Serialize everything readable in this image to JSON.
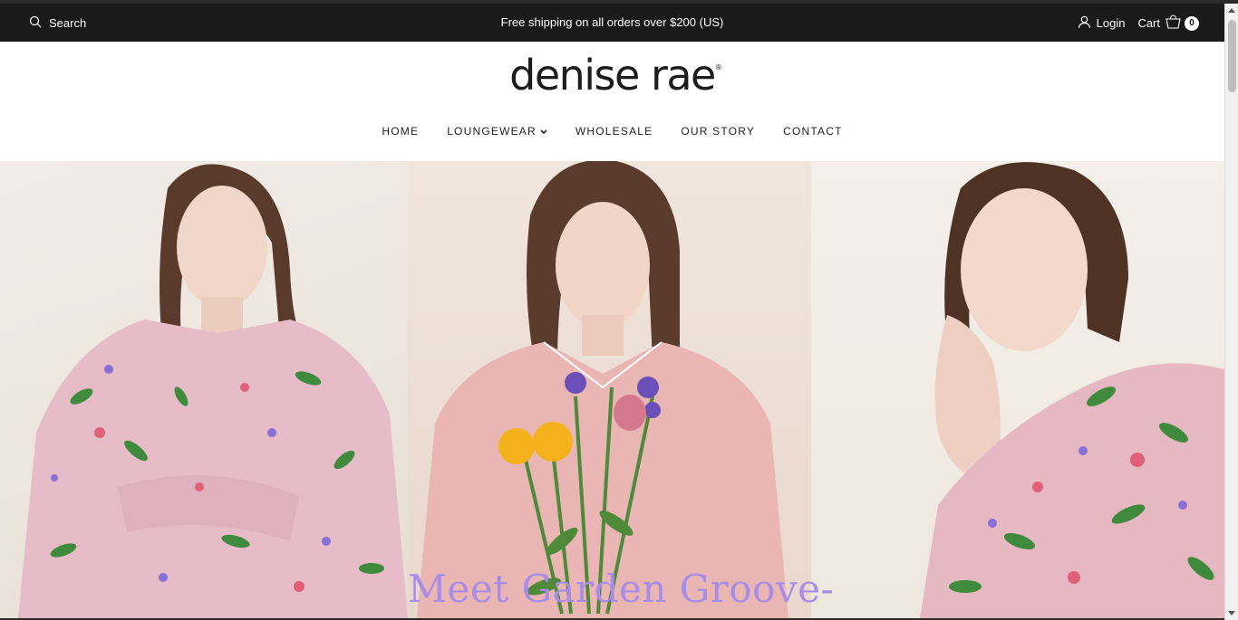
{
  "topbar": {
    "search_label": "Search",
    "announcement": "Free shipping on all orders over $200 (US)",
    "login_label": "Login",
    "cart_label": "Cart",
    "cart_count": "0"
  },
  "brand": {
    "logo_text": "denise rae",
    "logo_mark": "®"
  },
  "nav": {
    "items": [
      {
        "label": "HOME"
      },
      {
        "label": "LOUNGEWEAR"
      },
      {
        "label": "WHOLESALE"
      },
      {
        "label": "OUR STORY"
      },
      {
        "label": "CONTACT"
      }
    ]
  },
  "hero": {
    "title": "Meet Garden Groove-"
  },
  "icons": {
    "search": "search-icon",
    "user": "user-icon",
    "cart": "shopping-bag-icon",
    "dropdown": "chevron-down-icon"
  },
  "colors": {
    "topbar_bg": "#1a1a1a",
    "hero_title": "#a98ce8",
    "robe_pink": "#e8b9c6",
    "leaf_green": "#3f8a3c"
  }
}
